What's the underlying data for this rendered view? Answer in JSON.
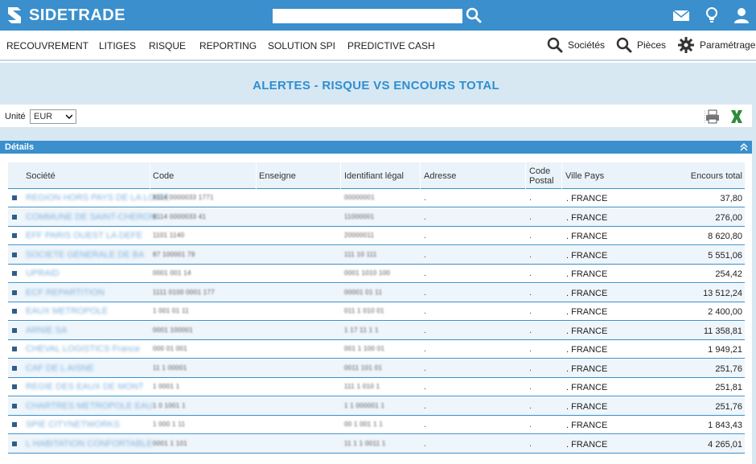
{
  "app": {
    "logo_text": "SIDETRADE",
    "brand_color": "#3a8fcc"
  },
  "topbar": {
    "search": {
      "value": "",
      "placeholder": ""
    },
    "icons": [
      "search-icon",
      "mail-icon",
      "lightbulb-icon",
      "user-icon"
    ]
  },
  "nav": {
    "items": [
      "RECOUVREMENT",
      "LITIGES",
      "RISQUE",
      "REPORTING",
      "SOLUTION SPI",
      "PREDICTIVE CASH"
    ],
    "right": [
      {
        "label": "Sociétés",
        "icon": "search-icon"
      },
      {
        "label": "Pièces",
        "icon": "search-icon"
      },
      {
        "label": "Paramétrage",
        "icon": "gear-icon"
      }
    ]
  },
  "page": {
    "title": "ALERTES - RISQUE VS ENCOURS TOTAL"
  },
  "unit": {
    "label": "Unité",
    "selected": "EUR"
  },
  "toolbar": {
    "icons": [
      "print-icon",
      "excel-icon"
    ]
  },
  "details": {
    "label": "Détails"
  },
  "table": {
    "columns": [
      "Société",
      "Code",
      "Enseigne",
      "Identifiant légal",
      "Adresse",
      "Code Postal",
      "Ville Pays",
      "Encours total"
    ],
    "rows": [
      {
        "societe": "REGION HORS PAYS DE LA LOIRE",
        "code": "8114 0000033 1771",
        "enseigne": "",
        "identifiant": "00000001",
        "adresse": ".",
        "code_postal": ".",
        "ville": ". FRANCE",
        "encours": "37,80"
      },
      {
        "societe": "COMMUNE DE SAINT-CHERON",
        "code": "8114 0000033 41",
        "enseigne": "",
        "identifiant": "11000001",
        "adresse": ".",
        "code_postal": ".",
        "ville": ". FRANCE",
        "encours": "276,00"
      },
      {
        "societe": "EFF PARIS OUEST LA DEFE",
        "code": "1101 1140",
        "enseigne": "",
        "identifiant": "20000011",
        "adresse": ".",
        "code_postal": ".",
        "ville": ". FRANCE",
        "encours": "8 620,80"
      },
      {
        "societe": "SOCIETE GENERALE DE BA",
        "code": "87 100001 79",
        "enseigne": "",
        "identifiant": "111 10 111",
        "adresse": ".",
        "code_postal": ".",
        "ville": ". FRANCE",
        "encours": "5 551,06"
      },
      {
        "societe": "UPRAID",
        "code": "0001 001 14",
        "enseigne": "",
        "identifiant": "0001 1010 100",
        "adresse": ".",
        "code_postal": ".",
        "ville": ". FRANCE",
        "encours": "254,42"
      },
      {
        "societe": "ECF REPARTITION",
        "code": "1111 0100 0001 177",
        "enseigne": "",
        "identifiant": "00001 01 11",
        "adresse": ".",
        "code_postal": ".",
        "ville": ". FRANCE",
        "encours": "13 512,24"
      },
      {
        "societe": "EAUX METROPOLE",
        "code": "1 001 01 11",
        "enseigne": "",
        "identifiant": "011 1 010 01",
        "adresse": ".",
        "code_postal": ".",
        "ville": ". FRANCE",
        "encours": "2 400,00"
      },
      {
        "societe": "ARNIE SA",
        "code": "0001 100001",
        "enseigne": "",
        "identifiant": "1 17 11 1 1",
        "adresse": ".",
        "code_postal": ".",
        "ville": ". FRANCE",
        "encours": "11 358,81"
      },
      {
        "societe": "CHEVAL LOGISTICS France",
        "code": "000 01 001",
        "enseigne": "",
        "identifiant": "001 1 100 01",
        "adresse": ".",
        "code_postal": ".",
        "ville": ". FRANCE",
        "encours": "1 949,21"
      },
      {
        "societe": "CAF DE L AISNE",
        "code": "11 1 00001",
        "enseigne": "",
        "identifiant": "0011 101 01",
        "adresse": ".",
        "code_postal": ".",
        "ville": ". FRANCE",
        "encours": "251,76"
      },
      {
        "societe": "REGIE DES EAUX DE MONT",
        "code": "1 0001 1",
        "enseigne": "",
        "identifiant": "111 1 010 1",
        "adresse": ".",
        "code_postal": ".",
        "ville": ". FRANCE",
        "encours": "251,81"
      },
      {
        "societe": "CHARTRES METROPOLE EAU",
        "code": "1 0 1001 1",
        "enseigne": "",
        "identifiant": "1 1 000001 1",
        "adresse": ".",
        "code_postal": ".",
        "ville": ". FRANCE",
        "encours": "251,76"
      },
      {
        "societe": "SPIE CITYNETWORKS",
        "code": "1 000 1 11",
        "enseigne": "",
        "identifiant": "00 1 001 1 1",
        "adresse": ".",
        "code_postal": ".",
        "ville": ". FRANCE",
        "encours": "1 843,43"
      },
      {
        "societe": "L HABITATION CONFORTABLE",
        "code": "0001 1 101",
        "enseigne": "",
        "identifiant": "11 1 1 0011 1",
        "adresse": ".",
        "code_postal": ".",
        "ville": ". FRANCE",
        "encours": "4 265,01"
      }
    ]
  }
}
